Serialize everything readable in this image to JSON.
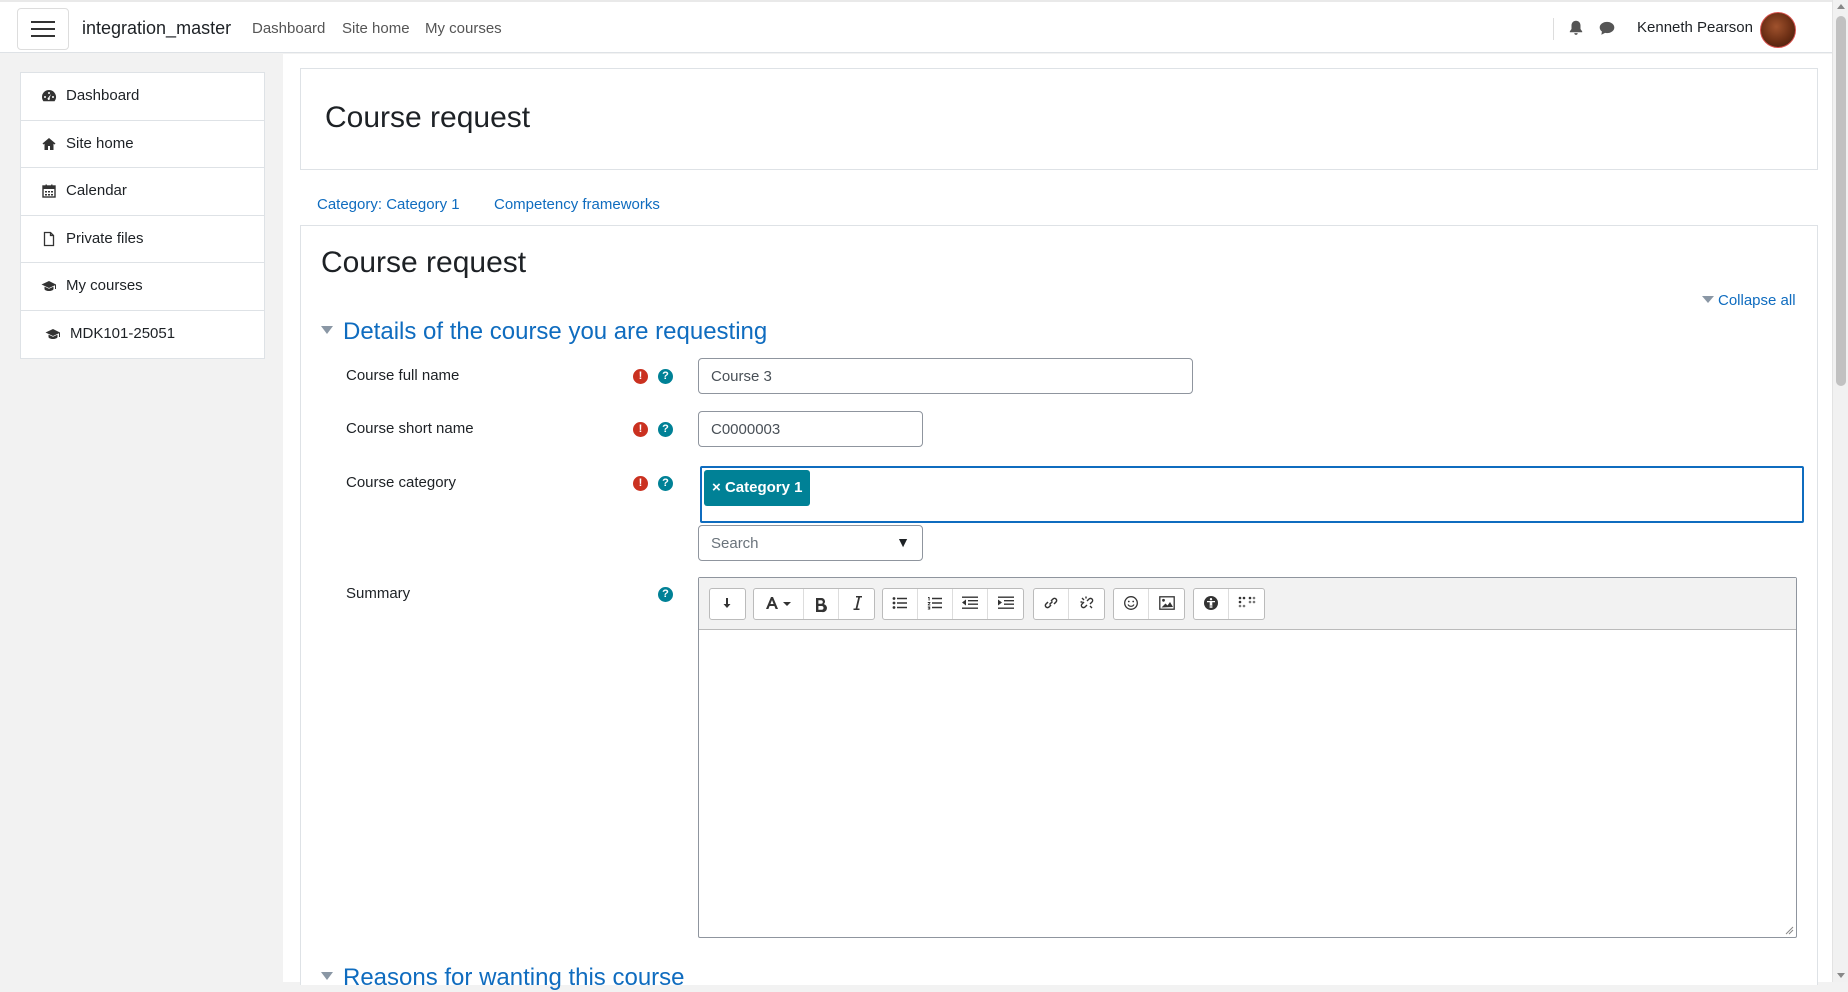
{
  "navbar": {
    "brand": "integration_master",
    "links": [
      "Dashboard",
      "Site home",
      "My courses"
    ],
    "user_name": "Kenneth Pearson"
  },
  "drawer": {
    "items": [
      {
        "label": "Dashboard",
        "icon": "dashboard-icon"
      },
      {
        "label": "Site home",
        "icon": "home-icon"
      },
      {
        "label": "Calendar",
        "icon": "calendar-icon"
      },
      {
        "label": "Private files",
        "icon": "file-icon"
      },
      {
        "label": "My courses",
        "icon": "graduation-cap-icon"
      },
      {
        "label": "MDK101-25051",
        "icon": "graduation-cap-icon"
      }
    ]
  },
  "header": {
    "title": "Course request"
  },
  "tabs": [
    "Category: Category 1",
    "Competency frameworks"
  ],
  "content": {
    "title": "Course request",
    "collapse_all": "Collapse all",
    "section1_title": "Details of the course you are requesting",
    "section2_title": "Reasons for wanting this course"
  },
  "form": {
    "fullname_label": "Course full name",
    "fullname_value": "Course 3",
    "shortname_label": "Course short name",
    "shortname_value": "C0000003",
    "category_label": "Course category",
    "category_selected": "Category 1",
    "category_remove": "×",
    "category_search_placeholder": "Search",
    "summary_label": "Summary"
  },
  "colors": {
    "link": "#0f6cbf",
    "required": "#ca3120",
    "help": "#008196",
    "badge": "#008196"
  }
}
